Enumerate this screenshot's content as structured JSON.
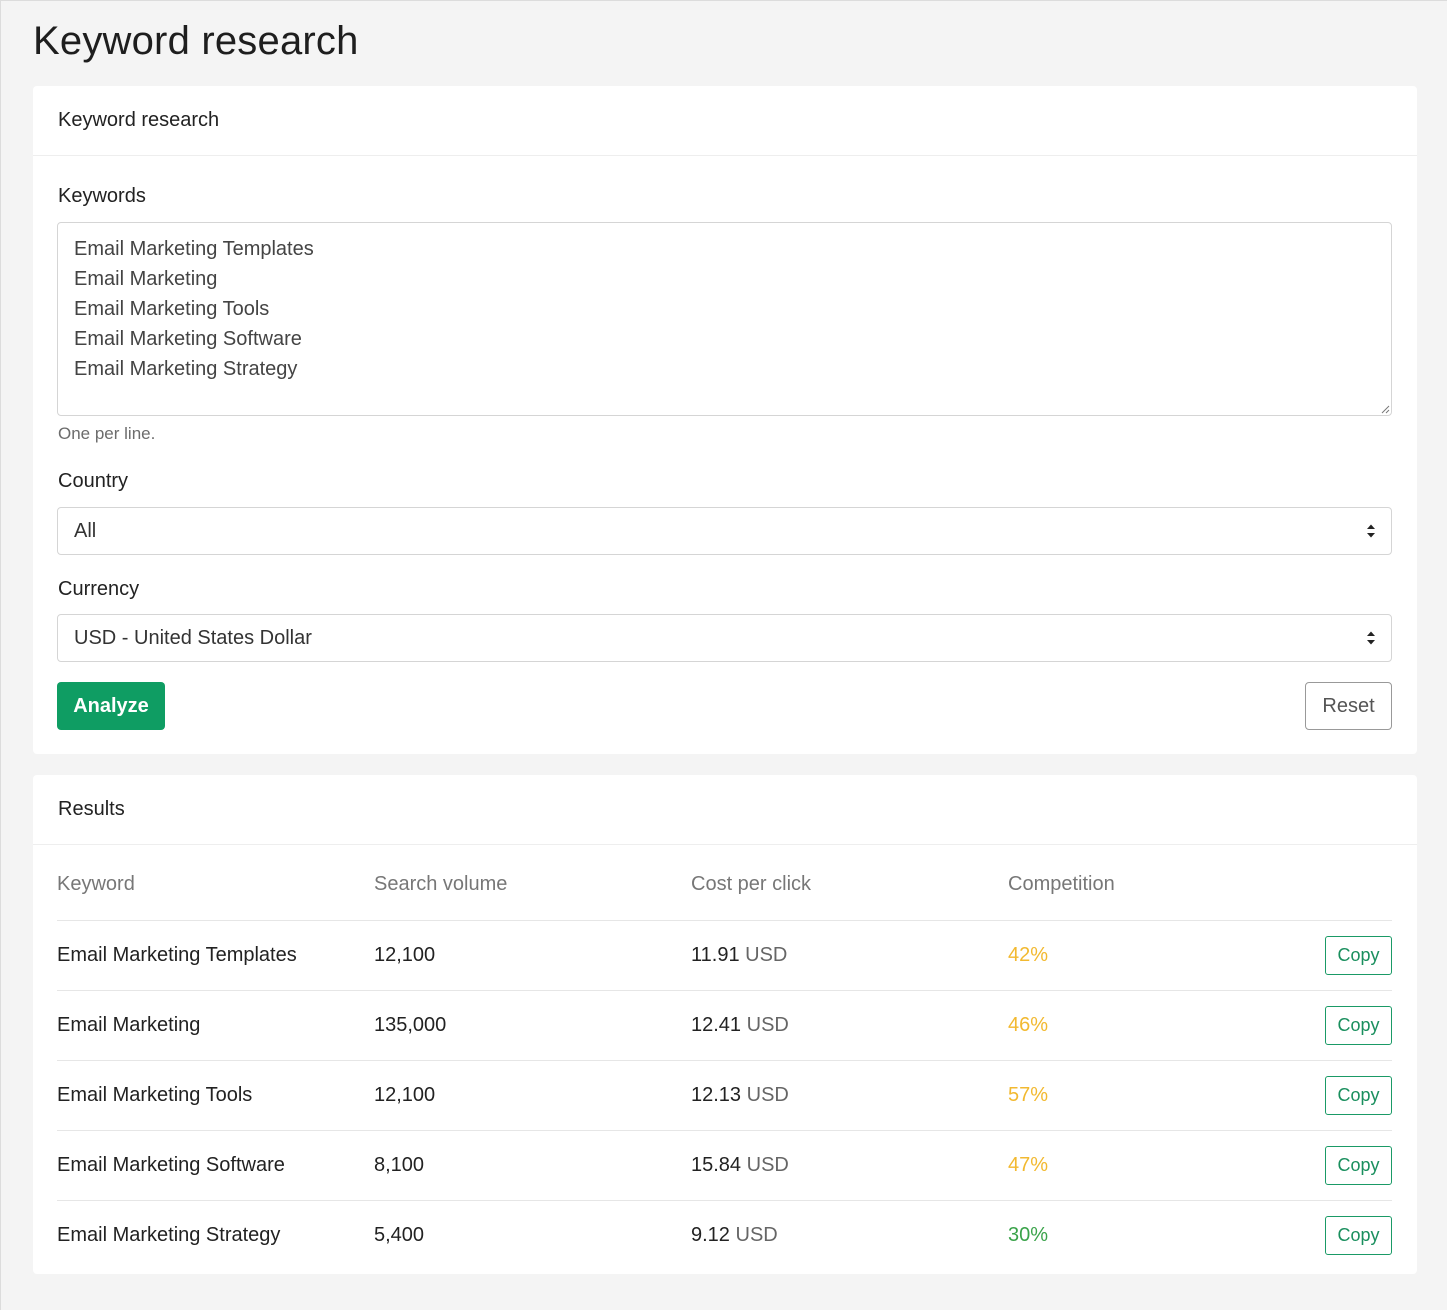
{
  "page_title": "Keyword research",
  "form": {
    "header": "Keyword research",
    "keywords_label": "Keywords",
    "keywords_value": "Email Marketing Templates\nEmail Marketing\nEmail Marketing Tools\nEmail Marketing Software\nEmail Marketing Strategy",
    "keywords_help": "One per line.",
    "country_label": "Country",
    "country_value": "All",
    "currency_label": "Currency",
    "currency_value": "USD - United States Dollar",
    "analyze_label": "Analyze",
    "reset_label": "Reset"
  },
  "results": {
    "header": "Results",
    "columns": [
      "Keyword",
      "Search volume",
      "Cost per click",
      "Competition"
    ],
    "copy_label": "Copy",
    "rows": [
      {
        "keyword": "Email Marketing Templates",
        "volume": "12,100",
        "cpc": "11.91",
        "currency": "USD",
        "competition": "42%",
        "competition_color": "#f2b930"
      },
      {
        "keyword": "Email Marketing",
        "volume": "135,000",
        "cpc": "12.41",
        "currency": "USD",
        "competition": "46%",
        "competition_color": "#f2b930"
      },
      {
        "keyword": "Email Marketing Tools",
        "volume": "12,100",
        "cpc": "12.13",
        "currency": "USD",
        "competition": "57%",
        "competition_color": "#f2b930"
      },
      {
        "keyword": "Email Marketing Software",
        "volume": "8,100",
        "cpc": "15.84",
        "currency": "USD",
        "competition": "47%",
        "competition_color": "#f2b930"
      },
      {
        "keyword": "Email Marketing Strategy",
        "volume": "5,400",
        "cpc": "9.12",
        "currency": "USD",
        "competition": "30%",
        "competition_color": "#3aa34a"
      }
    ]
  },
  "colors": {
    "accent": "#0f9d63",
    "competition_medium": "#f2b930",
    "competition_low": "#3aa34a"
  },
  "icons": {
    "select_caret": "sort-caret-icon",
    "textarea_resize": "resize-grip-icon"
  }
}
